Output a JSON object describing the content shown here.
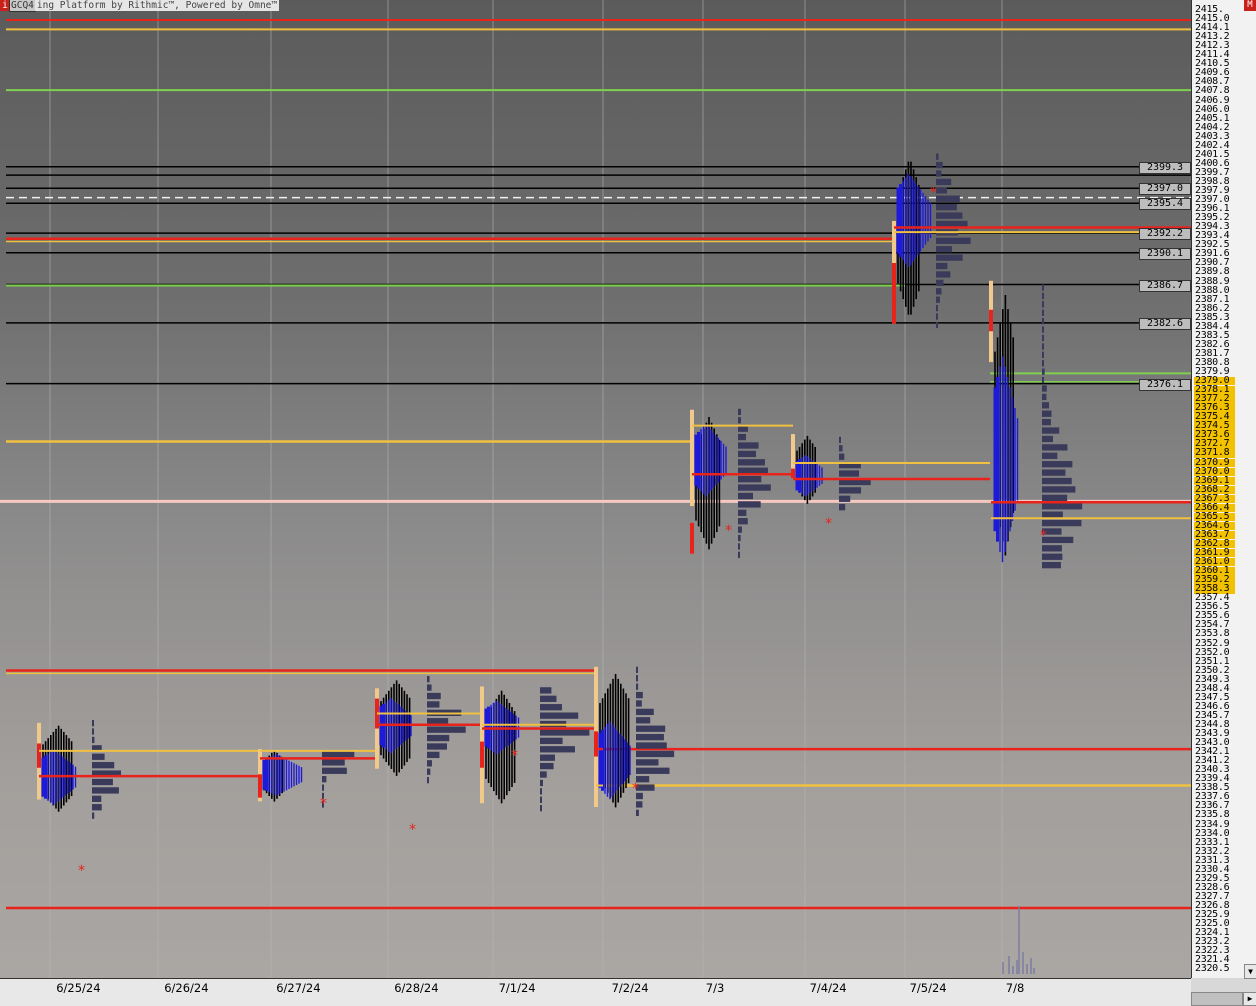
{
  "title_bar": {
    "icon_letter": "i",
    "symbol": "GCQ4",
    "text": "ing Platform by Rithmic™, Powered by Omne™"
  },
  "corner_badge": "M",
  "price_labels": [
    "2415.",
    "2415.0",
    "2414.1",
    "2413.2",
    "2412.3",
    "2411.4",
    "2410.5",
    "2409.6",
    "2408.7",
    "2407.8",
    "2406.9",
    "2406.0",
    "2405.1",
    "2404.2",
    "2403.3",
    "2402.4",
    "2401.5",
    "2400.6",
    "2399.7",
    "2398.8",
    "2397.9",
    "2397.0",
    "2396.1",
    "2395.2",
    "2394.3",
    "2393.4",
    "2392.5",
    "2391.6",
    "2390.7",
    "2389.8",
    "2388.9",
    "2388.0",
    "2387.1",
    "2386.2",
    "2385.3",
    "2384.4",
    "2383.5",
    "2382.6",
    "2381.7",
    "2380.8",
    "2379.9",
    "2379.0",
    "2378.1",
    "2377.2",
    "2376.3",
    "2375.4",
    "2374.5",
    "2373.6",
    "2372.7",
    "2371.8",
    "2370.9",
    "2370.0",
    "2369.1",
    "2368.2",
    "2367.3",
    "2366.4",
    "2365.5",
    "2364.6",
    "2363.7",
    "2362.8",
    "2361.9",
    "2361.0",
    "2360.1",
    "2359.2",
    "2358.3",
    "2357.4",
    "2356.5",
    "2355.6",
    "2354.7",
    "2353.8",
    "2352.9",
    "2352.0",
    "2351.1",
    "2350.2",
    "2349.3",
    "2348.4",
    "2347.5",
    "2346.6",
    "2345.7",
    "2344.8",
    "2343.9",
    "2343.0",
    "2342.1",
    "2341.2",
    "2340.3",
    "2339.4",
    "2338.5",
    "2337.6",
    "2336.7",
    "2335.8",
    "2334.9",
    "2334.0",
    "2333.1",
    "2332.2",
    "2331.3",
    "2330.4",
    "2329.5",
    "2328.6",
    "2327.7",
    "2326.8",
    "2325.9",
    "2325.0",
    "2324.1",
    "2323.2",
    "2322.3",
    "2321.4",
    "2320.5"
  ],
  "highlighted_price_range": [
    "2379.0",
    "2358.3"
  ],
  "level_labels": [
    "2399.3",
    "2397.0",
    "2395.4",
    "2392.2",
    "2390.1",
    "2386.7",
    "2382.6",
    "2376.1"
  ],
  "dates": [
    "6/25/24",
    "6/26/24",
    "6/27/24",
    "6/28/24",
    "7/1/24",
    "7/2/24",
    "7/3",
    "7/4/24",
    "7/5/24",
    "7/8"
  ],
  "colors": {
    "red": "#e8231c",
    "gold": "#f0c040",
    "green": "#7fd04f",
    "pink": "#f6c8c0",
    "blue": "#1d1ad8",
    "black": "#000000",
    "profile": "#3a3a5a",
    "va": "#f1c98a"
  }
}
